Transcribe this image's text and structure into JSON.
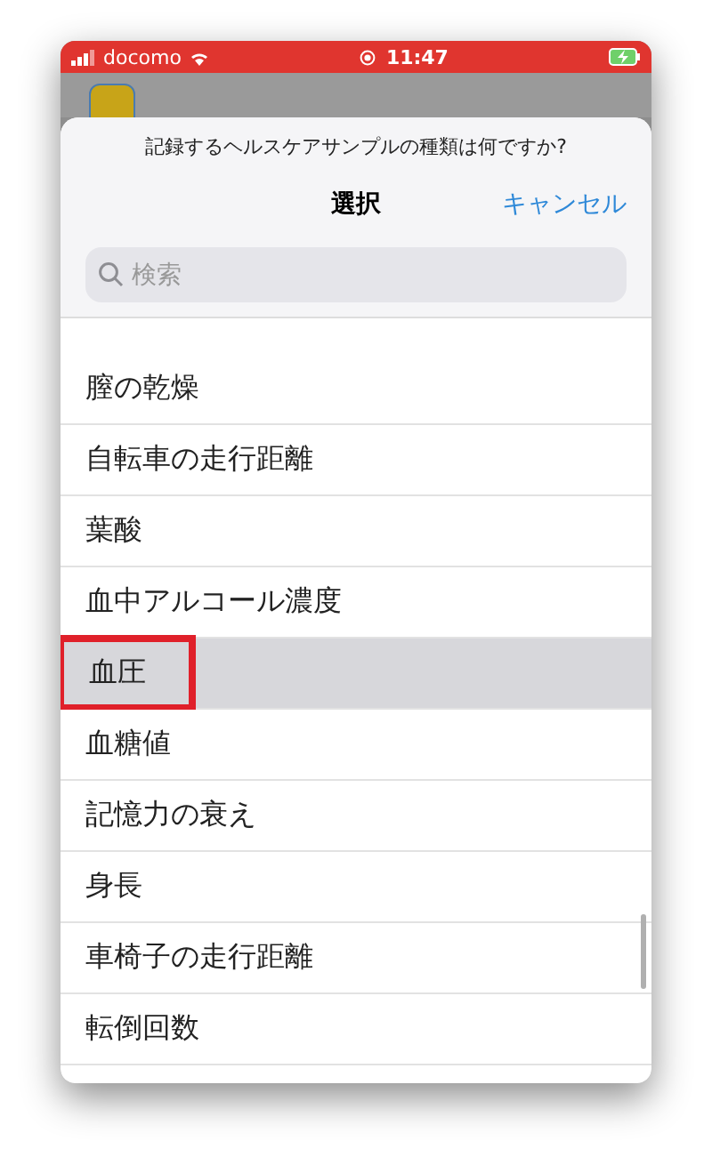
{
  "status_bar": {
    "carrier": "docomo",
    "time": "11:47"
  },
  "sheet": {
    "prompt": "記録するヘルスケアサンプルの種類は何ですか?",
    "title": "選択",
    "cancel": "キャンセル"
  },
  "search": {
    "placeholder": "検索"
  },
  "items": [
    {
      "label": "膣の乾燥",
      "selected": false
    },
    {
      "label": "自転車の走行距離",
      "selected": false
    },
    {
      "label": "葉酸",
      "selected": false
    },
    {
      "label": "血中アルコール濃度",
      "selected": false
    },
    {
      "label": "血圧",
      "selected": true
    },
    {
      "label": "血糖値",
      "selected": false
    },
    {
      "label": "記憶力の衰え",
      "selected": false
    },
    {
      "label": "身長",
      "selected": false
    },
    {
      "label": "車椅子の走行距離",
      "selected": false
    },
    {
      "label": "転倒回数",
      "selected": false
    }
  ]
}
